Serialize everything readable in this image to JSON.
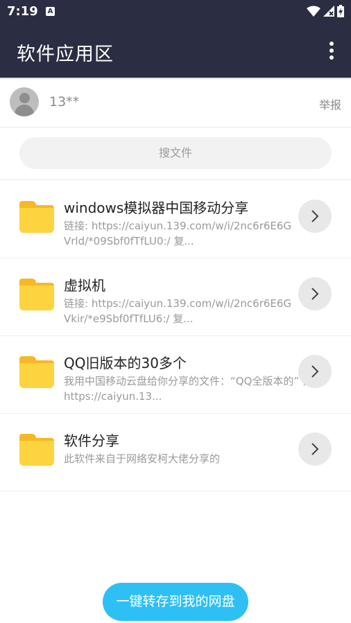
{
  "status_bar": {
    "time": "7:19",
    "notif_icon": "A"
  },
  "app_bar": {
    "title": "软件应用区",
    "menu_icon": "more-vert-icon"
  },
  "user": {
    "name": "13**",
    "report_label": "举报"
  },
  "search": {
    "label": "搜文件"
  },
  "files": [
    {
      "name": "windows模拟器中国移动分享",
      "desc": "链接: https://caiyun.139.com/w/i/2nc6r6E6GVrld/*09Sbf0fTfLU0:/ 复..."
    },
    {
      "name": "虚拟机",
      "desc": "链接: https://caiyun.139.com/w/i/2nc6r6E6GVkir/*e9Sbf0fTfLU6:/ 复..."
    },
    {
      "name": "QQ旧版本的30多个",
      "desc": "我用中国移动云盘给你分享的文件：“QQ全版本的” 链接: https://caiyun.13..."
    },
    {
      "name": "软件分享",
      "desc": "此软件来自于网络安柯大佬分享的"
    }
  ],
  "cta": {
    "label": "一键转存到我的网盘"
  },
  "colors": {
    "app_bar": "#2b2d42",
    "accent": "#2ec0f5",
    "folder": "#fdd33f"
  }
}
